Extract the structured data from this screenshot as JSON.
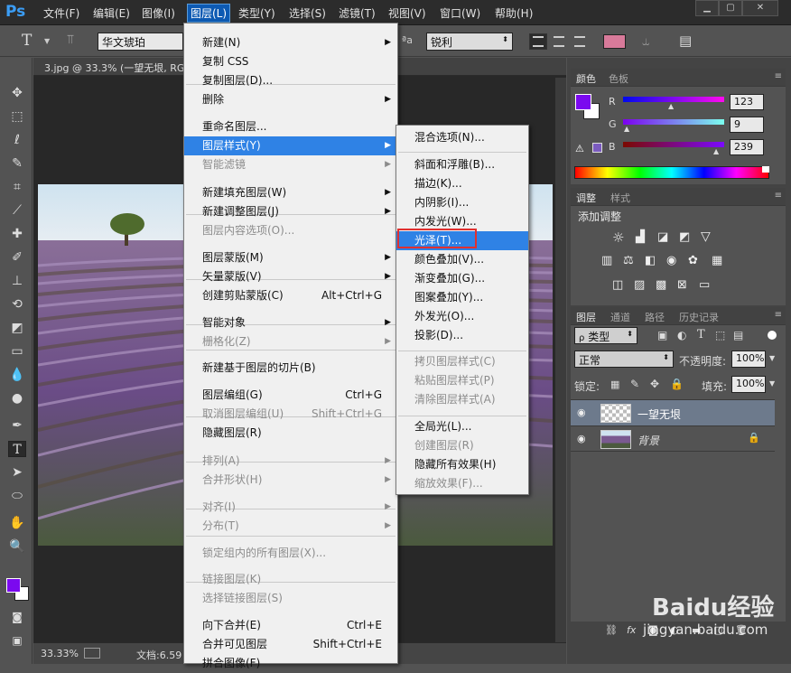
{
  "app": {
    "logo": "Ps"
  },
  "menubar": {
    "items": [
      "文件(F)",
      "编辑(E)",
      "图像(I)",
      "图层(L)",
      "类型(Y)",
      "选择(S)",
      "滤镜(T)",
      "视图(V)",
      "窗口(W)",
      "帮助(H)"
    ]
  },
  "options": {
    "font_family": "华文琥珀",
    "antialias": "锐利",
    "aa_label": "a",
    "text_color": "#d87a9a"
  },
  "document": {
    "tab_title": "3.jpg @ 33.3% (一望无垠, RG",
    "zoom": "33.33%",
    "doc_info": "文档:6.59"
  },
  "layer_menu": {
    "items": [
      {
        "label": "新建(N)",
        "submenu": true
      },
      {
        "label": "复制 CSS"
      },
      {
        "label": "复制图层(D)..."
      },
      {
        "label": "删除",
        "submenu": true
      },
      {
        "label": "重命名图层..."
      },
      {
        "label": "图层样式(Y)",
        "submenu": true,
        "highlight": true
      },
      {
        "label": "智能滤镜",
        "disabled": true,
        "submenu": true
      },
      {
        "label": "新建填充图层(W)",
        "submenu": true
      },
      {
        "label": "新建调整图层(J)",
        "submenu": true
      },
      {
        "label": "图层内容选项(O)...",
        "disabled": true
      },
      {
        "label": "图层蒙版(M)",
        "submenu": true
      },
      {
        "label": "矢量蒙版(V)",
        "submenu": true
      },
      {
        "label": "创建剪贴蒙版(C)",
        "shortcut": "Alt+Ctrl+G"
      },
      {
        "label": "智能对象",
        "submenu": true
      },
      {
        "label": "栅格化(Z)",
        "disabled": true,
        "submenu": true
      },
      {
        "label": "新建基于图层的切片(B)"
      },
      {
        "label": "图层编组(G)",
        "shortcut": "Ctrl+G"
      },
      {
        "label": "取消图层编组(U)",
        "shortcut": "Shift+Ctrl+G",
        "disabled": true
      },
      {
        "label": "隐藏图层(R)"
      },
      {
        "label": "排列(A)",
        "disabled": true,
        "submenu": true
      },
      {
        "label": "合并形状(H)",
        "disabled": true,
        "submenu": true
      },
      {
        "label": "对齐(I)",
        "disabled": true,
        "submenu": true
      },
      {
        "label": "分布(T)",
        "disabled": true,
        "submenu": true
      },
      {
        "label": "锁定组内的所有图层(X)...",
        "disabled": true
      },
      {
        "label": "链接图层(K)",
        "disabled": true
      },
      {
        "label": "选择链接图层(S)",
        "disabled": true
      },
      {
        "label": "向下合并(E)",
        "shortcut": "Ctrl+E"
      },
      {
        "label": "合并可见图层",
        "shortcut": "Shift+Ctrl+E"
      },
      {
        "label": "拼合图像(F)"
      }
    ]
  },
  "style_menu": {
    "items": [
      {
        "label": "混合选项(N)..."
      },
      {
        "label": "斜面和浮雕(B)..."
      },
      {
        "label": "描边(K)..."
      },
      {
        "label": "内阴影(I)..."
      },
      {
        "label": "内发光(W)..."
      },
      {
        "label": "光泽(T)...",
        "highlight": true
      },
      {
        "label": "颜色叠加(V)..."
      },
      {
        "label": "渐变叠加(G)..."
      },
      {
        "label": "图案叠加(Y)..."
      },
      {
        "label": "外发光(O)..."
      },
      {
        "label": "投影(D)..."
      },
      {
        "label": "拷贝图层样式(C)",
        "disabled": true
      },
      {
        "label": "粘贴图层样式(P)",
        "disabled": true
      },
      {
        "label": "清除图层样式(A)",
        "disabled": true
      },
      {
        "label": "全局光(L)..."
      },
      {
        "label": "创建图层(R)",
        "disabled": true
      },
      {
        "label": "隐藏所有效果(H)"
      },
      {
        "label": "缩放效果(F)...",
        "disabled": true
      }
    ]
  },
  "color_panel": {
    "tabs": [
      "颜色",
      "色板"
    ],
    "r_label": "R",
    "g_label": "G",
    "b_label": "B",
    "r": "123",
    "g": "9",
    "b": "239",
    "foreground": "#7b09ef"
  },
  "adjust_panel": {
    "tabs": [
      "调整",
      "样式"
    ],
    "title": "添加调整"
  },
  "layers_panel": {
    "tabs": [
      "图层",
      "通道",
      "路径",
      "历史记录"
    ],
    "filter_kind": "类型",
    "blend_mode": "正常",
    "opacity_label": "不透明度:",
    "opacity": "100%",
    "lock_label": "锁定:",
    "fill_label": "填充:",
    "fill": "100%",
    "layers": [
      {
        "name": "一望无垠",
        "selected": true
      },
      {
        "name": "背景",
        "locked": true
      }
    ]
  },
  "watermark": {
    "brand": "Baidu经验",
    "url": "jingyan.baidu.com"
  }
}
